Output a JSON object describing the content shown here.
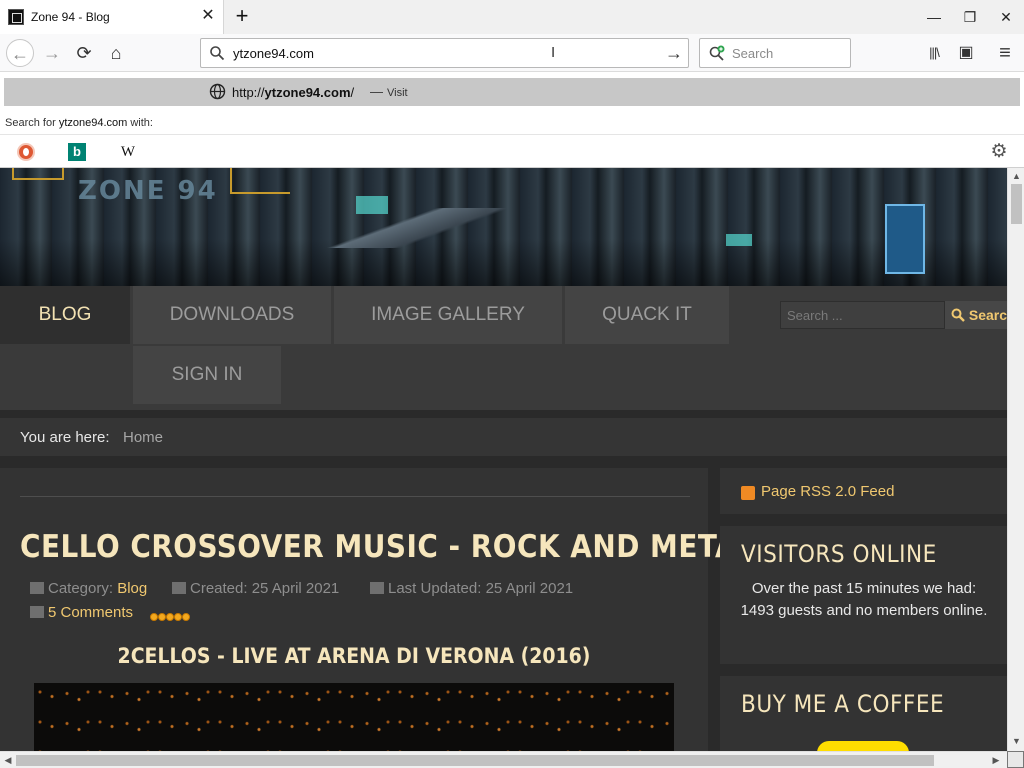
{
  "browser": {
    "tab": {
      "title": "Zone 94 - Blog",
      "close": "✕"
    },
    "new_tab": "+",
    "window": {
      "minimize": "—",
      "restore": "❐",
      "close": "✕"
    },
    "nav": {
      "back": "←",
      "forward": "→",
      "reload": "⟳",
      "home": "⌂"
    },
    "urlbar": {
      "value": "ytzone94.com",
      "go": "→"
    },
    "searchbar": {
      "placeholder": "Search"
    },
    "toolbar": {
      "library": "|||\\",
      "sidebar": "▣",
      "menu": "≡"
    },
    "suggestion": {
      "url_prefix": "http://",
      "url_domain": "ytzone94.com",
      "url_suffix": "/",
      "dash": "—",
      "action": "Visit"
    },
    "search_with": {
      "prefix": "Search for ",
      "term": "ytzone94.com",
      "suffix": " with:"
    },
    "engines": {
      "bing": "b",
      "wikipedia": "W"
    },
    "settings": "⚙"
  },
  "site": {
    "banner_logo": "ZONE 94",
    "menu": [
      {
        "label": "BLOG",
        "active": true
      },
      {
        "label": "DOWNLOADS"
      },
      {
        "label": "IMAGE GALLERY"
      },
      {
        "label": "QUACK IT"
      },
      {
        "label": "SIGN IN"
      }
    ],
    "search": {
      "placeholder": "Search ...",
      "button": "Search"
    },
    "breadcrumb": {
      "label": "You are here:",
      "home": "Home"
    },
    "article": {
      "title": "CELLO CROSSOVER MUSIC - ROCK AND METAL",
      "category_label": "Category:",
      "category": "Blog",
      "created": "Created: 25 April 2021",
      "updated": "Last Updated: 25 April 2021",
      "comments": "5 Comments",
      "subhead": "2CELLOS - LIVE AT ARENA DI VERONA (2016)"
    },
    "sidebar": {
      "rss": "Page RSS 2.0 Feed",
      "visitors_title": "VISITORS ONLINE",
      "visitors_text": "Over the past 15 minutes we had: 1493 guests and no members online.",
      "coffee_title": "BUY ME A COFFEE"
    }
  },
  "colors": {
    "accent_gold": "#f0c870",
    "title_cream": "#f6e6bc",
    "page_bg": "#2a2a2a",
    "rating_orange": "#f3a91f"
  }
}
